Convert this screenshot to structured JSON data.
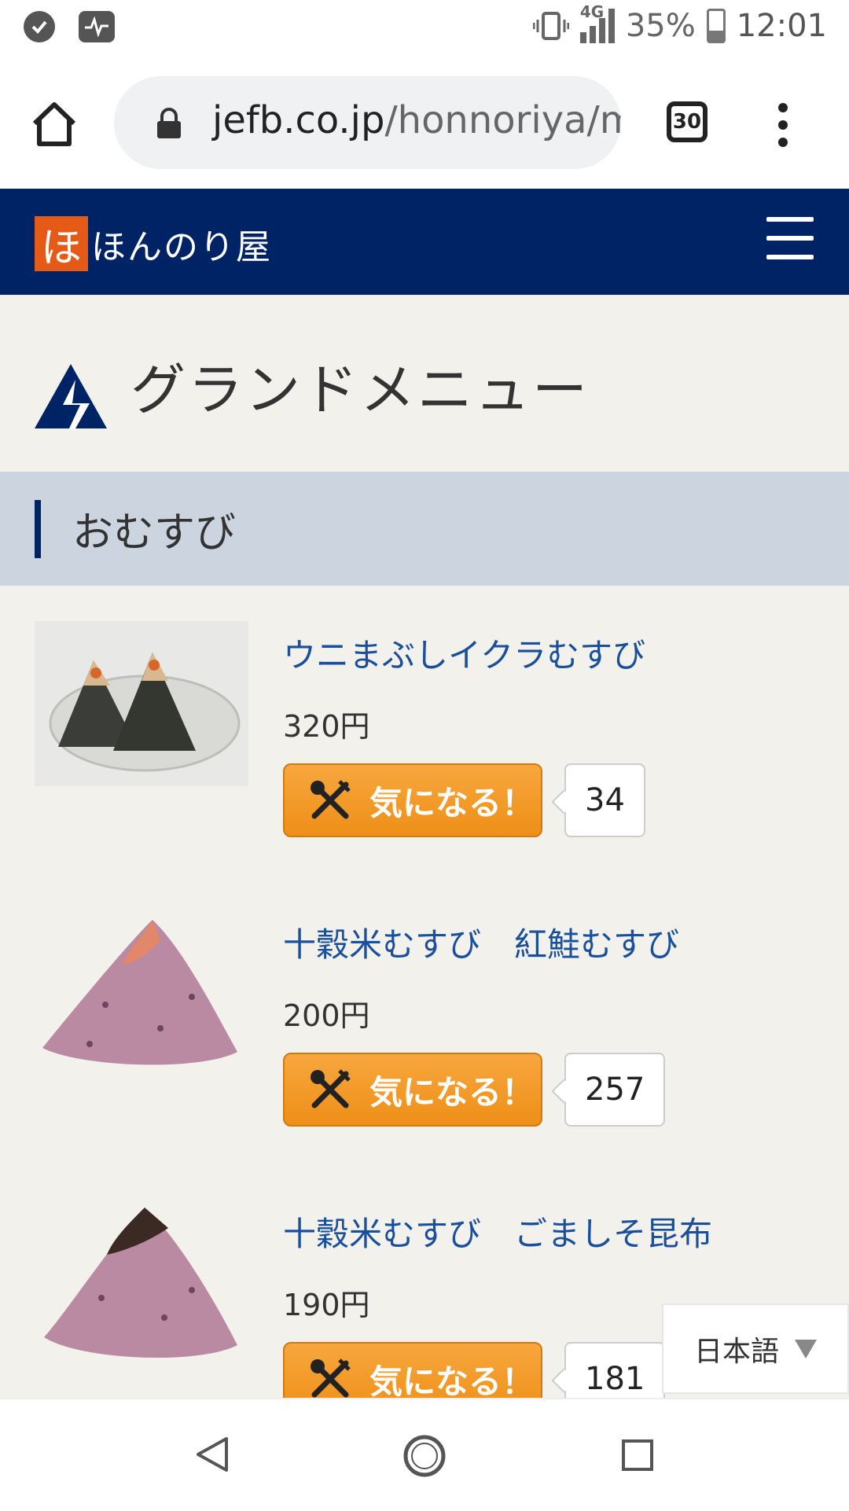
{
  "status_bar": {
    "network": "4G",
    "battery": "35%",
    "time": "12:01",
    "icons": [
      "check-circle-icon",
      "activity-icon",
      "vibrate-icon",
      "signal-icon",
      "battery-icon"
    ]
  },
  "browser": {
    "url_domain": "jefb.co.jp",
    "url_path": "/honnoriya/m",
    "tab_count": "30"
  },
  "site": {
    "logo_text": "ほんのり屋"
  },
  "page": {
    "title": "グランドメニュー",
    "section_title": "おむすび"
  },
  "menu_items": [
    {
      "name": "ウニまぶしイクラむすび",
      "price": "320円",
      "like_label": "気になる！",
      "count": "34"
    },
    {
      "name": "十穀米むすび　紅鮭むすび",
      "price": "200円",
      "like_label": "気になる！",
      "count": "257"
    },
    {
      "name": "十穀米むすび　ごましそ昆布",
      "price": "190円",
      "like_label": "気になる！",
      "count": "181"
    }
  ],
  "language_selector": {
    "value": "日本語"
  },
  "colors": {
    "brand_navy": "#002366",
    "accent_orange": "#f29a2e",
    "link_blue": "#1a4f9c",
    "logo_orange": "#e55a17"
  }
}
